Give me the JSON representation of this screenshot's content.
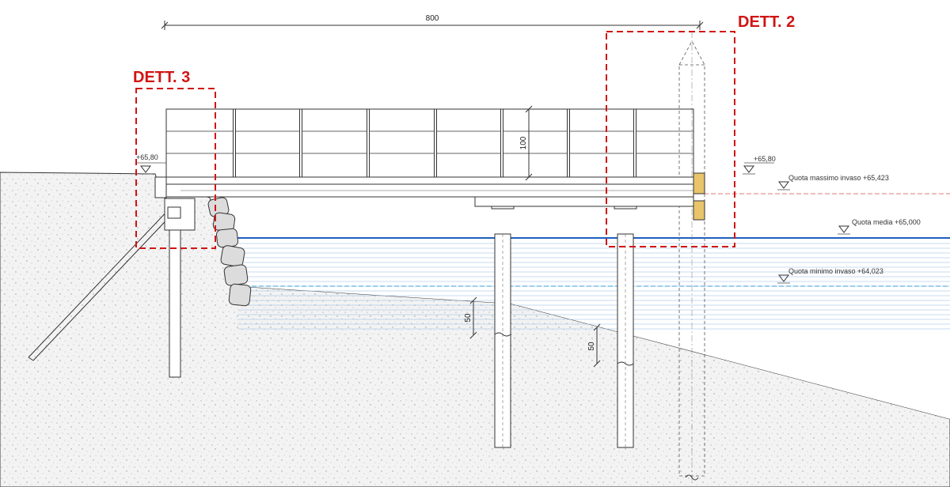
{
  "dimensions": {
    "span": "800",
    "railing_height": "100",
    "embed_left": "50",
    "embed_right": "50"
  },
  "levels": {
    "deck_left": "+65,80",
    "deck_right": "+65,80",
    "max": "Quota massimo invaso +65,423",
    "mean": "Quota media +65,000",
    "min": "Quota minimo invaso +64,023"
  },
  "details": {
    "dett2": "DETT. 2",
    "dett3": "DETT. 3"
  },
  "colors": {
    "detail_box": "#d11414",
    "water_main": "#1f5fbf",
    "water_lines": "#6fa6dd",
    "max_level": "#e07a7a",
    "min_level": "#3aa0d8",
    "soil": "#f2f2f2"
  }
}
